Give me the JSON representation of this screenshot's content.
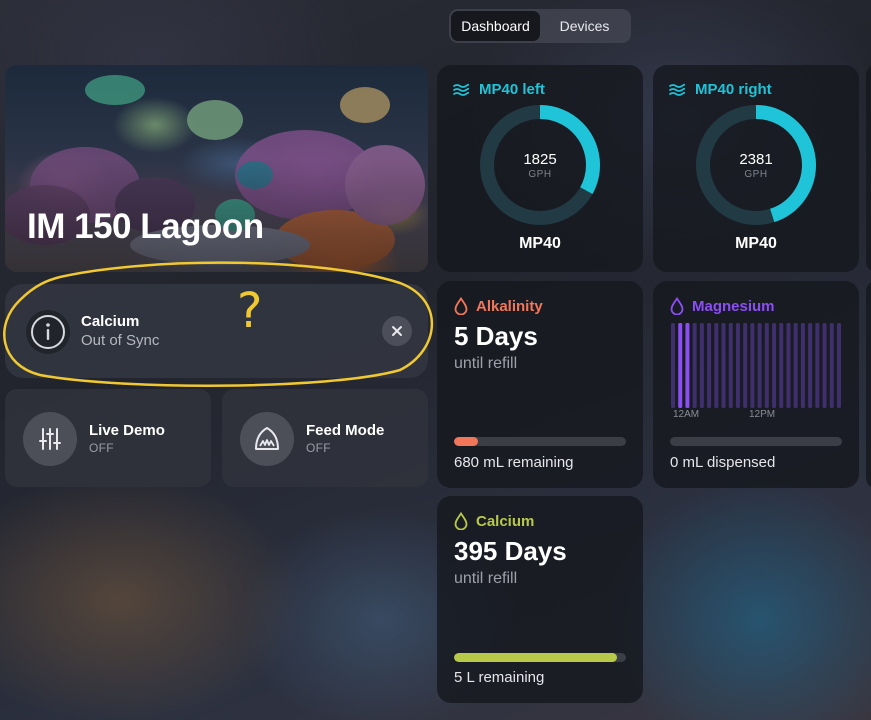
{
  "nav": {
    "tabs": [
      {
        "label": "Dashboard",
        "active": true
      },
      {
        "label": "Devices",
        "active": false
      }
    ]
  },
  "hero": {
    "title": "IM 150 Lagoon"
  },
  "notification": {
    "title": "Calcium",
    "subtitle": "Out of Sync",
    "annotation_mark": "?"
  },
  "modes": [
    {
      "label": "Live Demo",
      "state": "OFF",
      "icon": "sliders-icon"
    },
    {
      "label": "Feed Mode",
      "state": "OFF",
      "icon": "fish-mouth-icon"
    }
  ],
  "pumps": [
    {
      "name": "MP40 left",
      "value": "1825",
      "unit": "GPH",
      "model": "MP40",
      "fraction": 0.33
    },
    {
      "name": "MP40 right",
      "value": "2381",
      "unit": "GPH",
      "model": "MP40",
      "fraction": 0.45
    }
  ],
  "dosing": {
    "alkalinity": {
      "name": "Alkalinity",
      "big": "5 Days",
      "until": "until refill",
      "remaining": "680 mL remaining",
      "fraction": 0.14,
      "color": "#f2775a"
    },
    "magnesium": {
      "name": "Magnesium",
      "dispensed": "0 mL dispensed",
      "ticks": [
        "12AM",
        "12PM"
      ],
      "color": "#8b4ef5",
      "active_bars": [
        1,
        2
      ]
    },
    "calcium": {
      "name": "Calcium",
      "big": "395 Days",
      "until": "until refill",
      "remaining": "5 L remaining",
      "fraction": 0.95,
      "color": "#b8c94a"
    }
  },
  "colors": {
    "accent": "#1fc4d8",
    "annotation": "#f0c832"
  }
}
